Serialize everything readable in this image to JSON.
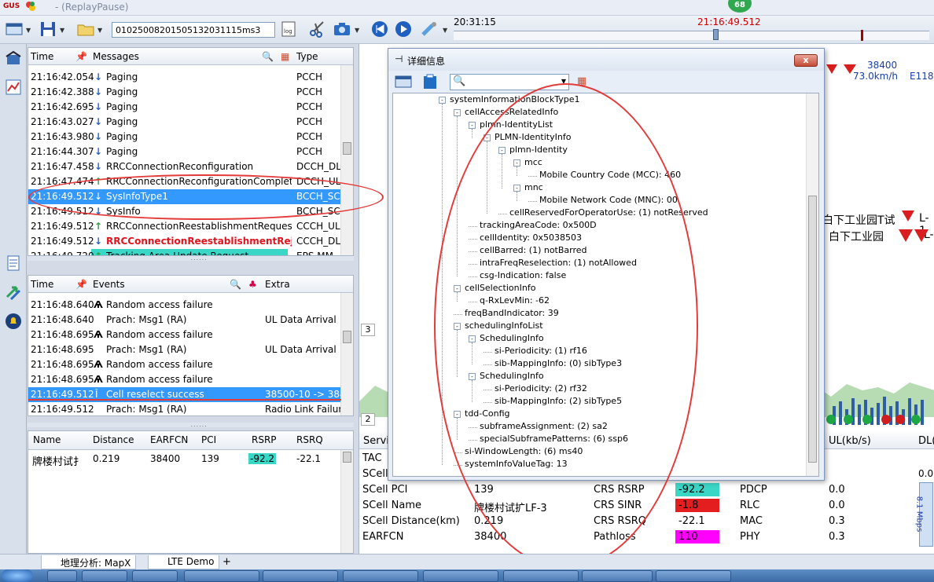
{
  "window": {
    "title": "- (ReplayPause)"
  },
  "toolbar": {
    "file_input": "01025008201505132031115ms3",
    "time_start": "20:31:15",
    "time_current": "21:16:49.512",
    "badge": "68"
  },
  "messages": {
    "headers": {
      "time": "Time",
      "messages": "Messages",
      "type": "Type"
    },
    "rows": [
      {
        "time": "21:16:42.054",
        "msg": "Paging",
        "type": "PCCH",
        "dir": "down"
      },
      {
        "time": "21:16:42.388",
        "msg": "Paging",
        "type": "PCCH",
        "dir": "down"
      },
      {
        "time": "21:16:42.695",
        "msg": "Paging",
        "type": "PCCH",
        "dir": "down"
      },
      {
        "time": "21:16:43.027",
        "msg": "Paging",
        "type": "PCCH",
        "dir": "down"
      },
      {
        "time": "21:16:43.980",
        "msg": "Paging",
        "type": "PCCH",
        "dir": "down"
      },
      {
        "time": "21:16:44.307",
        "msg": "Paging",
        "type": "PCCH",
        "dir": "down"
      },
      {
        "time": "21:16:47.458",
        "msg": "RRCConnectionReconfiguration",
        "type": "DCCH_DL",
        "dir": "down"
      },
      {
        "time": "21:16:47.474",
        "msg": "RRCConnectionReconfigurationComplete",
        "type": "DCCH_UL",
        "dir": "up"
      },
      {
        "time": "21:16:49.512",
        "msg": "SysInfoType1",
        "type": "BCCH_SC",
        "dir": "down"
      },
      {
        "time": "21:16:49.512",
        "msg": "SysInfo",
        "type": "BCCH_SC",
        "dir": "down"
      },
      {
        "time": "21:16:49.512",
        "msg": "RRCConnectionReestablishmentRequest",
        "type": "CCCH_UL",
        "dir": "up"
      },
      {
        "time": "21:16:49.512",
        "msg": "RRCConnectionReestablishmentReject",
        "type": "CCCH_DL",
        "dir": "down"
      },
      {
        "time": "21:16:49.720",
        "msg": "Tracking Area Update Request",
        "type": "EPS MM",
        "dir": "up"
      }
    ]
  },
  "events": {
    "headers": {
      "time": "Time",
      "events": "Events",
      "extra": "Extra"
    },
    "rows": [
      {
        "time": "21:16:48.640",
        "event": "Random access failure",
        "extra": ""
      },
      {
        "time": "21:16:48.640",
        "event": "Prach: Msg1 (RA)",
        "extra": "UL Data Arrival"
      },
      {
        "time": "21:16:48.695",
        "event": "Random access failure",
        "extra": ""
      },
      {
        "time": "21:16:48.695",
        "event": "Prach: Msg1 (RA)",
        "extra": "UL Data Arrival"
      },
      {
        "time": "21:16:48.695",
        "event": "Random access failure",
        "extra": ""
      },
      {
        "time": "21:16:48.695",
        "event": "Random access failure",
        "extra": ""
      },
      {
        "time": "21:16:49.512",
        "event": "Cell reselect success",
        "extra": "38500-10 -> 3840"
      },
      {
        "time": "21:16:49.512",
        "event": "Prach: Msg1 (RA)",
        "extra": "Radio Link Failure"
      }
    ]
  },
  "cells": {
    "headers": [
      "Name",
      "Distance",
      "EARFCN",
      "PCI",
      "RSRP",
      "RSRQ"
    ],
    "row": {
      "name": "牌楼村试扌",
      "distance": "0.219",
      "earfcn": "38400",
      "pci": "139",
      "rsrp": "-92.2",
      "rsrq": "-22.1"
    }
  },
  "dialog": {
    "title": "详细信息",
    "close": "x",
    "tree": [
      {
        "d": 0,
        "t": "systemInformationBlockType1",
        "box": "-"
      },
      {
        "d": 1,
        "t": "cellAccessRelatedInfo",
        "box": "-"
      },
      {
        "d": 2,
        "t": "plmn-IdentityList",
        "box": "-"
      },
      {
        "d": 3,
        "t": "PLMN-IdentityInfo",
        "box": "-"
      },
      {
        "d": 4,
        "t": "plmn-Identity",
        "box": "-"
      },
      {
        "d": 5,
        "t": "mcc",
        "box": "-"
      },
      {
        "d": 6,
        "t": "Mobile Country Code (MCC): 460",
        "box": ""
      },
      {
        "d": 5,
        "t": "mnc",
        "box": "-"
      },
      {
        "d": 6,
        "t": "Mobile Network Code (MNC): 00",
        "box": ""
      },
      {
        "d": 4,
        "t": "cellReservedForOperatorUse: (1) notReserved",
        "box": ""
      },
      {
        "d": 2,
        "t": "trackingAreaCode: 0x500D",
        "box": ""
      },
      {
        "d": 2,
        "t": "cellIdentity: 0x5038503",
        "box": ""
      },
      {
        "d": 2,
        "t": "cellBarred: (1) notBarred",
        "box": ""
      },
      {
        "d": 2,
        "t": "intraFreqReselection: (1) notAllowed",
        "box": ""
      },
      {
        "d": 2,
        "t": "csg-Indication: false",
        "box": ""
      },
      {
        "d": 1,
        "t": "cellSelectionInfo",
        "box": "-"
      },
      {
        "d": 2,
        "t": "q-RxLevMin: -62",
        "box": ""
      },
      {
        "d": 1,
        "t": "freqBandIndicator: 39",
        "box": ""
      },
      {
        "d": 1,
        "t": "schedulingInfoList",
        "box": "-"
      },
      {
        "d": 2,
        "t": "SchedulingInfo",
        "box": "-"
      },
      {
        "d": 3,
        "t": "si-Periodicity: (1) rf16",
        "box": ""
      },
      {
        "d": 3,
        "t": "sib-MappingInfo: (0) sibType3",
        "box": ""
      },
      {
        "d": 2,
        "t": "SchedulingInfo",
        "box": "-"
      },
      {
        "d": 3,
        "t": "si-Periodicity: (2) rf32",
        "box": ""
      },
      {
        "d": 3,
        "t": "sib-MappingInfo: (2) sibType5",
        "box": ""
      },
      {
        "d": 1,
        "t": "tdd-Config",
        "box": "-"
      },
      {
        "d": 2,
        "t": "subframeAssignment: (2) sa2",
        "box": ""
      },
      {
        "d": 2,
        "t": "specialSubframePatterns: (6) ssp6",
        "box": ""
      },
      {
        "d": 1,
        "t": "si-WindowLength: (6) ms40",
        "box": ""
      },
      {
        "d": 1,
        "t": "systemInfoValueTag: 13",
        "box": ""
      }
    ]
  },
  "rightpane": {
    "map_speed": "73.0km/h",
    "map_coord": "E118.8",
    "map_label1": "白下工业园T试",
    "map_label1b": "L-1",
    "map_label2": "白下工业园",
    "map_label2b": "L-",
    "map_top": "38400 ",
    "tab3": "3",
    "tab2": "2",
    "serving": {
      "col_head_left": "Servi",
      "ul_head": "UL(kb/s)",
      "dl_head": "DL(",
      "tac_label": "TAC",
      "scell_label": "SCell",
      "dl_val0": "0.00",
      "rows": [
        {
          "label": "SCell PCI",
          "value": "139",
          "metric": "CRS RSRP",
          "metric_val": "-92.2",
          "layer": "PDCP",
          "ul": "0.0"
        },
        {
          "label": "SCell Name",
          "value": "牌楼村试扩LF-3",
          "metric": "CRS SINR",
          "metric_val": "-1.8",
          "layer": "RLC",
          "ul": "0.0"
        },
        {
          "label": "SCell Distance(km)",
          "value": "0.219",
          "metric": "CRS RSRQ",
          "metric_val": "-22.1",
          "layer": "MAC",
          "ul": "0.3"
        },
        {
          "label": "EARFCN",
          "value": "38400",
          "metric": "Pathloss",
          "metric_val": "110",
          "layer": "PHY",
          "ul": "0.3"
        }
      ],
      "side_label": "8.1 Mbps"
    }
  },
  "bottomtabs": {
    "tab1": "地理分析: MapX",
    "tab2": "LTE Demo",
    "add": "+"
  },
  "colors": {
    "selection": "#3399ff",
    "rsrp": "#3ad6c6",
    "sinr": "#e41e1e",
    "pathloss": "#ff00ff",
    "annotation": "#e53a3a"
  }
}
